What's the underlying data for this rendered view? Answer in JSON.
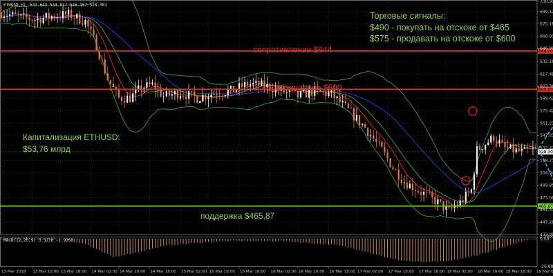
{
  "chart_data": {
    "type": "candlestick",
    "instrument_label": "ETHUSD,H1",
    "ohlc_label": "532.643 534.817 526.357 528.301",
    "y_ticks": [
      "700.950",
      "689.120",
      "675.180",
      "660.930",
      "646.990",
      "632.180",
      "617.480",
      "603.365",
      "589.620",
      "575.420",
      "561.230",
      "547.030",
      "532.420",
      "518.230",
      "504.040",
      "489.850",
      "475.660",
      "461.470",
      "447.280",
      "433.090"
    ],
    "y_range": [
      433.09,
      700.95
    ],
    "x_ticks": [
      "13 Mar 2018",
      "13 Mar 10:00",
      "13 Mar 18:00",
      "14 Mar 02:00",
      "14 Mar 10:00",
      "14 Mar 18:00",
      "15 Mar 02:00",
      "15 Mar 10:00",
      "15 Mar 18:00",
      "16 Mar 02:00",
      "16 Mar 10:00",
      "16 Mar 18:00",
      "17 Mar 02:00",
      "17 Mar 10:00",
      "17 Mar 18:00",
      "18 Mar 02:00",
      "18 Mar 10:00",
      "18 Mar 18:00",
      "19 Mar 02:00"
    ],
    "price_anchors": [
      [
        0,
        688
      ],
      [
        6,
        683
      ],
      [
        12,
        680
      ],
      [
        18,
        684
      ],
      [
        24,
        686
      ],
      [
        30,
        678
      ],
      [
        34,
        650
      ],
      [
        38,
        612
      ],
      [
        42,
        590
      ],
      [
        46,
        590
      ],
      [
        50,
        602
      ],
      [
        54,
        605
      ],
      [
        58,
        592
      ],
      [
        64,
        596
      ],
      [
        70,
        590
      ],
      [
        76,
        596
      ],
      [
        82,
        598
      ],
      [
        88,
        606
      ],
      [
        94,
        604
      ],
      [
        100,
        598
      ],
      [
        106,
        592
      ],
      [
        112,
        598
      ],
      [
        118,
        594
      ],
      [
        124,
        576
      ],
      [
        130,
        556
      ],
      [
        136,
        530
      ],
      [
        140,
        510
      ],
      [
        144,
        494
      ],
      [
        148,
        486
      ],
      [
        152,
        478
      ],
      [
        156,
        470
      ],
      [
        160,
        460
      ],
      [
        164,
        470
      ],
      [
        168,
        484
      ],
      [
        170,
        530
      ],
      [
        174,
        540
      ],
      [
        176,
        545
      ],
      [
        180,
        532
      ],
      [
        186,
        528
      ],
      [
        190,
        530
      ]
    ],
    "price_levels": [
      {
        "label": "сопротивление $644",
        "value": 644,
        "color": "#d9362a"
      },
      {
        "label": "сопротивление $600",
        "value": 600,
        "color": "#d9362a"
      },
      {
        "label": "поддержка $465,87",
        "value": 465.87,
        "color": "#7ed321"
      }
    ],
    "level_tags": [
      "644.000",
      "600.000",
      "465.870"
    ],
    "current_price_tag": "528.301",
    "macd": {
      "label": "MACD(12,26,9) 3.3216 -1.9253",
      "y_ticks": [
        "2.2601",
        "0.00",
        "-26.8864"
      ],
      "y_range": [
        -26.8864,
        2.2601
      ],
      "anchors": [
        [
          0,
          1
        ],
        [
          20,
          1
        ],
        [
          30,
          -5
        ],
        [
          40,
          -18
        ],
        [
          50,
          -12
        ],
        [
          60,
          -6
        ],
        [
          80,
          -2
        ],
        [
          100,
          -2
        ],
        [
          120,
          -6
        ],
        [
          130,
          -12
        ],
        [
          140,
          -20
        ],
        [
          150,
          -23
        ],
        [
          160,
          -22
        ],
        [
          170,
          -16
        ],
        [
          180,
          -8
        ],
        [
          190,
          1
        ]
      ]
    },
    "forecast_path": [
      [
        192,
        532
      ],
      [
        206,
        600
      ],
      [
        212,
        580
      ]
    ],
    "forecast_path_2": [
      [
        192,
        532
      ],
      [
        200,
        478
      ],
      [
        210,
        495
      ]
    ],
    "title": "",
    "xlabel": "",
    "ylabel": ""
  },
  "annotations": {
    "signals_title": "Торговые сигналы:",
    "signals_line1": "$490 - покупать на отскоке от $465",
    "signals_line2": "$575 - продавать на отскоке от $600",
    "cap_line1": "Капитализация ETHUSD:",
    "cap_line2": "$53,76 млрд"
  },
  "colors": {
    "background": "#000000",
    "grid": "#3a3f46",
    "bull": "#f0f0f0",
    "bear": "#e07b39",
    "resistance": "#d9362a",
    "support": "#7ed321",
    "forecast": "#4fa8d8",
    "ma_fast": "#e03030",
    "ma_mid": "#3ea83e",
    "ma_slow": "#3a3ad8",
    "bands": "#3a9a3a"
  }
}
